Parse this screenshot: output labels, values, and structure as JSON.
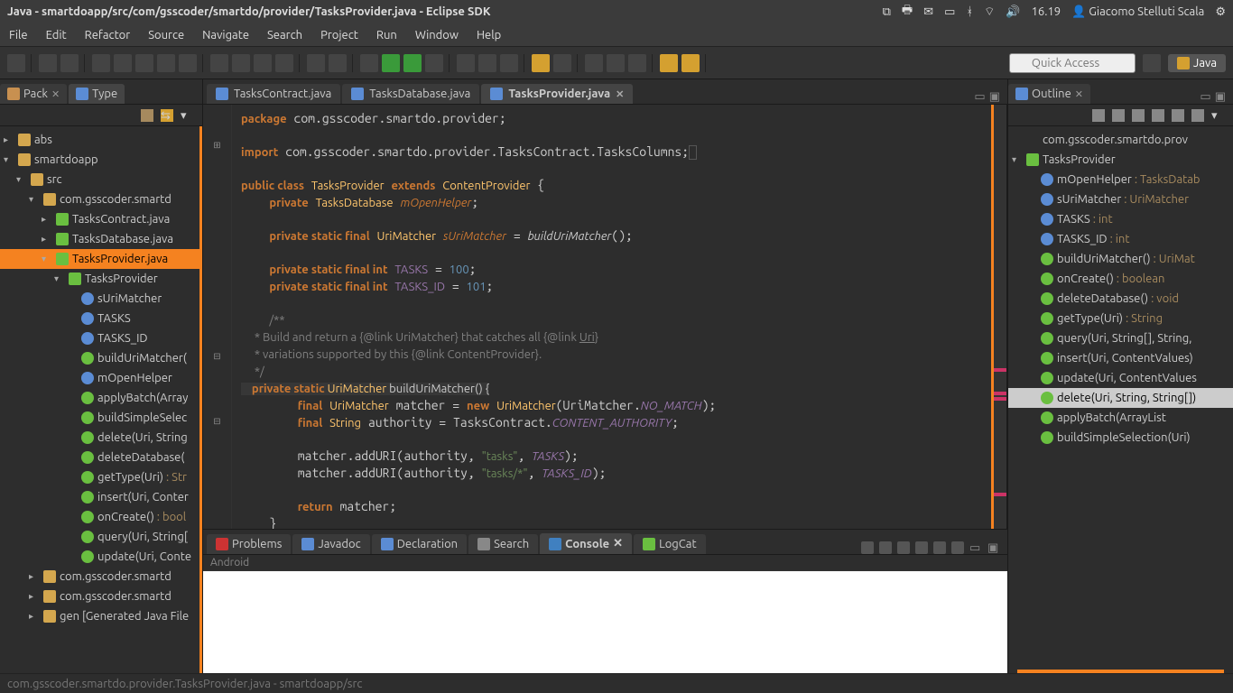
{
  "titlebar": {
    "title": "Java - smartdoapp/src/com/gsscoder/smartdo/provider/TasksProvider.java - Eclipse SDK",
    "time": "16.19",
    "user": "Giacomo Stelluti Scala"
  },
  "menu": [
    "File",
    "Edit",
    "Refactor",
    "Source",
    "Navigate",
    "Search",
    "Project",
    "Run",
    "Window",
    "Help"
  ],
  "quick_access_placeholder": "Quick Access",
  "perspective": "Java",
  "left": {
    "tabs": [
      {
        "label": "Pack",
        "active": true
      },
      {
        "label": "Type",
        "active": false
      }
    ],
    "tree": [
      {
        "d": 0,
        "a": "▸",
        "i": "pkg",
        "t": "abs"
      },
      {
        "d": 0,
        "a": "▾",
        "i": "pkg",
        "t": "smartdoapp"
      },
      {
        "d": 1,
        "a": "▾",
        "i": "pkg",
        "t": "src"
      },
      {
        "d": 2,
        "a": "▾",
        "i": "pkg",
        "t": "com.gsscoder.smartd"
      },
      {
        "d": 3,
        "a": "▸",
        "i": "cls",
        "t": "TasksContract.java"
      },
      {
        "d": 3,
        "a": "▸",
        "i": "cls",
        "t": "TasksDatabase.java"
      },
      {
        "d": 3,
        "a": "▾",
        "i": "cls",
        "t": "TasksProvider.java",
        "sel": true
      },
      {
        "d": 4,
        "a": "▾",
        "i": "cls",
        "t": "TasksProvider"
      },
      {
        "d": 5,
        "a": "",
        "i": "fld",
        "t": "sUriMatcher"
      },
      {
        "d": 5,
        "a": "",
        "i": "fld",
        "t": "TASKS"
      },
      {
        "d": 5,
        "a": "",
        "i": "fld",
        "t": "TASKS_ID"
      },
      {
        "d": 5,
        "a": "",
        "i": "mth",
        "t": "buildUriMatcher("
      },
      {
        "d": 5,
        "a": "",
        "i": "fld",
        "t": "mOpenHelper"
      },
      {
        "d": 5,
        "a": "",
        "i": "mth",
        "t": "applyBatch(Array"
      },
      {
        "d": 5,
        "a": "",
        "i": "mth",
        "t": "buildSimpleSelec"
      },
      {
        "d": 5,
        "a": "",
        "i": "mth",
        "t": "delete(Uri, String"
      },
      {
        "d": 5,
        "a": "",
        "i": "mth",
        "t": "deleteDatabase("
      },
      {
        "d": 5,
        "a": "",
        "i": "mth",
        "t": "getType(Uri)",
        "hint": " : Str"
      },
      {
        "d": 5,
        "a": "",
        "i": "mth",
        "t": "insert(Uri, Conter"
      },
      {
        "d": 5,
        "a": "",
        "i": "mth",
        "t": "onCreate()",
        "hint": " : bool"
      },
      {
        "d": 5,
        "a": "",
        "i": "mth",
        "t": "query(Uri, String["
      },
      {
        "d": 5,
        "a": "",
        "i": "mth",
        "t": "update(Uri, Conte"
      },
      {
        "d": 2,
        "a": "▸",
        "i": "pkg",
        "t": "com.gsscoder.smartd"
      },
      {
        "d": 2,
        "a": "▸",
        "i": "pkg",
        "t": "com.gsscoder.smartd"
      },
      {
        "d": 2,
        "a": "▸",
        "i": "pkg",
        "t": "gen [Generated Java File"
      }
    ]
  },
  "editor": {
    "tabs": [
      {
        "label": "TasksContract.java",
        "active": false
      },
      {
        "label": "TasksDatabase.java",
        "active": false
      },
      {
        "label": "TasksProvider.java",
        "active": true
      }
    ]
  },
  "outline": {
    "title": "Outline",
    "items": [
      {
        "d": 0,
        "a": "",
        "i": "pkg",
        "t": "com.gsscoder.smartdo.prov"
      },
      {
        "d": 0,
        "a": "▾",
        "i": "c",
        "t": "TasksProvider"
      },
      {
        "d": 1,
        "a": "",
        "i": "f",
        "t": "mOpenHelper",
        "hint": " : TasksDatab"
      },
      {
        "d": 1,
        "a": "",
        "i": "f",
        "t": "sUriMatcher",
        "hint": " : UriMatcher"
      },
      {
        "d": 1,
        "a": "",
        "i": "f",
        "t": "TASKS",
        "hint": " : int"
      },
      {
        "d": 1,
        "a": "",
        "i": "f",
        "t": "TASKS_ID",
        "hint": " : int"
      },
      {
        "d": 1,
        "a": "",
        "i": "m",
        "t": "buildUriMatcher()",
        "hint": " : UriMat"
      },
      {
        "d": 1,
        "a": "",
        "i": "m",
        "t": "onCreate()",
        "hint": " : boolean"
      },
      {
        "d": 1,
        "a": "",
        "i": "m",
        "t": "deleteDatabase()",
        "hint": " : void"
      },
      {
        "d": 1,
        "a": "",
        "i": "m",
        "t": "getType(Uri)",
        "hint": " : String"
      },
      {
        "d": 1,
        "a": "",
        "i": "m",
        "t": "query(Uri, String[], String, "
      },
      {
        "d": 1,
        "a": "",
        "i": "m",
        "t": "insert(Uri, ContentValues)"
      },
      {
        "d": 1,
        "a": "",
        "i": "m",
        "t": "update(Uri, ContentValues"
      },
      {
        "d": 1,
        "a": "",
        "i": "m",
        "t": "delete(Uri, String, String[])",
        "sel": true
      },
      {
        "d": 1,
        "a": "",
        "i": "m",
        "t": "applyBatch(ArrayList<Con"
      },
      {
        "d": 1,
        "a": "",
        "i": "m",
        "t": "buildSimpleSelection(Uri)"
      }
    ]
  },
  "bottom_tabs": [
    {
      "label": "Problems"
    },
    {
      "label": "Javadoc"
    },
    {
      "label": "Declaration"
    },
    {
      "label": "Search"
    },
    {
      "label": "Console",
      "active": true
    },
    {
      "label": "LogCat"
    }
  ],
  "console_title": "Android",
  "statusbar": "com.gsscoder.smartdo.provider.TasksProvider.java - smartdoapp/src"
}
